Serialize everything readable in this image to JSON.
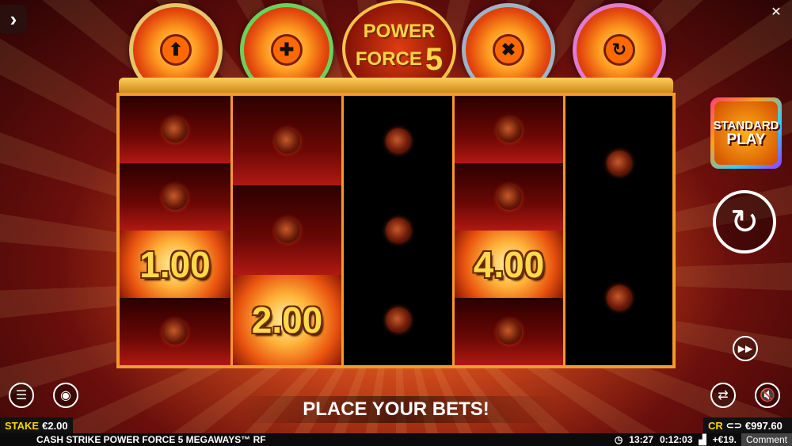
{
  "game": {
    "logo_line1": "POWER",
    "logo_line2": "FORCE",
    "logo_num": "5"
  },
  "coins": [
    {
      "name": "upgrade-coin",
      "symbol": "⬆",
      "ring": "#e8c46a"
    },
    {
      "name": "extra-coin",
      "symbol": "✚",
      "ring": "#6ad25a"
    },
    {
      "name": "multiplier-coin",
      "symbol": "✖",
      "ring": "#9fb3c8"
    },
    {
      "name": "respin-coin",
      "symbol": "↻",
      "ring": "#e27ad0"
    }
  ],
  "reels": {
    "prizes": [
      "1.00",
      "2.00",
      "4.00"
    ]
  },
  "side": {
    "standard_line1": "STANDARD",
    "standard_line2": "PLAY"
  },
  "message": "PLACE YOUR BETS!",
  "stake": {
    "label": "STAKE",
    "value": "€2.00"
  },
  "credit": {
    "label": "CR",
    "value": "€997.60"
  },
  "footer": {
    "game_name": "CASH STRIKE POWER FORCE 5 MEGAWAYS™ RF",
    "clock": "13:27",
    "session": "0:12:03",
    "net": "+€19.",
    "comment": "Comment"
  },
  "colors": {
    "accent": "#f39a2c",
    "stake_label": "#ffd400"
  }
}
